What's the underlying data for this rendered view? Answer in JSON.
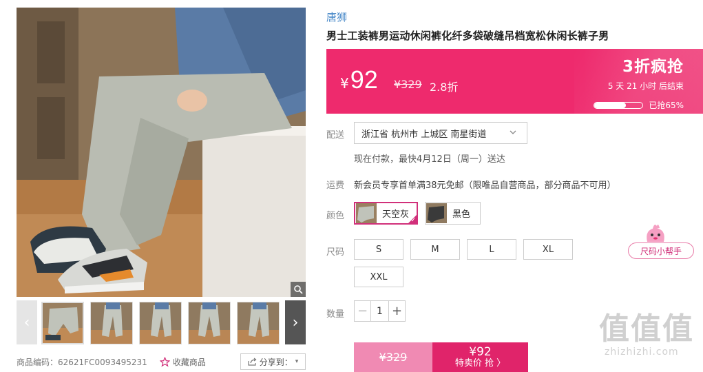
{
  "gallery": {
    "sku_code": "商品编码：62621FC0093495231",
    "favorite_label": "收藏商品",
    "share_label": "分享到：",
    "thumb_count": 6
  },
  "product": {
    "brand": "唐狮",
    "title": "男士工装裤男运动休闲裤化纤多袋破缝吊档宽松休闲长裤子男"
  },
  "price": {
    "currency": "¥",
    "current": "92",
    "original": "¥329",
    "discount": "2.8折",
    "promo_title": "3折疯抢",
    "countdown": "5  天 21 小时 后结束",
    "sold_label": "已抢65%",
    "sold_fraction": 0.65
  },
  "delivery": {
    "label": "配送",
    "address": "浙江省 杭州市 上城区 南星街道",
    "eta": "现在付款，最快4月12日（周一）送达"
  },
  "shipping": {
    "label": "运费",
    "text": "新会员专享首单满38元免邮（限唯品自营商品，部分商品不可用）"
  },
  "color": {
    "label": "颜色",
    "options": [
      "天空灰",
      "黑色"
    ],
    "selected": "天空灰"
  },
  "size": {
    "label": "尺码",
    "options": [
      "S",
      "M",
      "L",
      "XL",
      "XXL"
    ],
    "helper": "尺码小帮手"
  },
  "quantity": {
    "label": "数量",
    "value": "1",
    "minus": "−",
    "plus": "+"
  },
  "buy": {
    "original": "¥329",
    "price": "¥92",
    "action": "特卖价 抢 〉"
  },
  "watermark": {
    "big": "值值值",
    "small": "zhizhizhi.com"
  },
  "colors": {
    "accent": "#ee2a6d",
    "brand_link": "#4a8ac9",
    "selected_border": "#d1307a"
  }
}
